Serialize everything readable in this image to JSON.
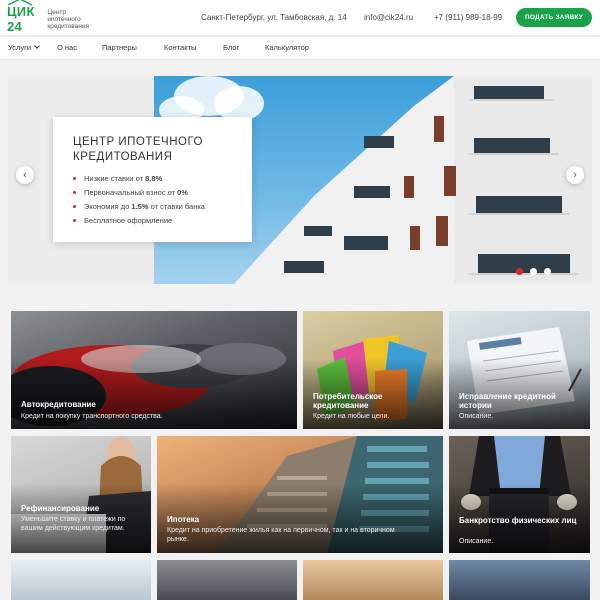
{
  "header": {
    "logo_name": "ЦИК 24",
    "logo_sub1": "Центр",
    "logo_sub2": "ипотечного",
    "logo_sub3": "кредитования",
    "address": "Санкт-Петербург, ул. Тамбовская, д. 14",
    "email": "info@cik24.ru",
    "phone": "+7 (911) 989-18-99",
    "cta_label": "Подать заявку"
  },
  "nav": {
    "items": [
      "Услуги",
      "О нас",
      "Партнеры",
      "Контакты",
      "Блог",
      "Калькулятор"
    ]
  },
  "hero": {
    "title_line1": "Центр ипотечного",
    "title_line2": "кредитования",
    "bullets": [
      {
        "text": "Низкие ставки от ",
        "strong": "8.8%",
        "tail": ""
      },
      {
        "text": "Первоначальный взнос от ",
        "strong": "0%",
        "tail": ""
      },
      {
        "text": "Экономия до ",
        "strong": "1.5%",
        "tail": " от ставки банка"
      },
      {
        "text": "Бесплатное оформление",
        "strong": "",
        "tail": ""
      }
    ],
    "prev_icon": "‹",
    "next_icon": "›",
    "slides_total": 3,
    "active_slide": 1
  },
  "services": [
    {
      "title": "Автокредитование",
      "desc": "Кредит на покупку транспортного средства."
    },
    {
      "title": "Потребительское кредитование",
      "desc": "Кредит на любые цели."
    },
    {
      "title": "Исправление кредитной истории",
      "desc": "Описание."
    },
    {
      "title": "Рефинансирование",
      "desc": "Уменьшите ставку и платежи по вашим действующим кредитам."
    },
    {
      "title": "Ипотека",
      "desc": "Кредит на приобретение жилья как на первичном, так и на вторичном рынке."
    },
    {
      "title": "Банкротство физических лиц",
      "desc": "Описание."
    }
  ],
  "colors": {
    "accent": "#1aa24a",
    "red": "#d6282c"
  }
}
